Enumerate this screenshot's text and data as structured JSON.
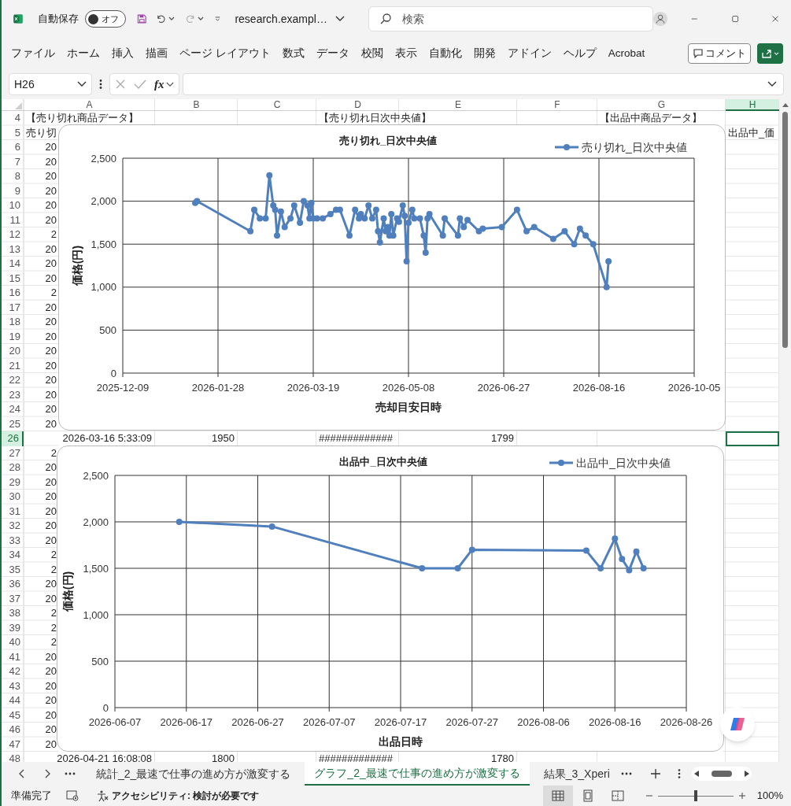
{
  "title_bar": {
    "autosave_label": "自動保存",
    "autosave_on": false,
    "autosave_text": "オフ",
    "filename": "research.exampl…",
    "search": {
      "placeholder": "検索"
    }
  },
  "ribbon_tabs": [
    "ファイル",
    "ホーム",
    "挿入",
    "描画",
    "ページ レイアウト",
    "数式",
    "データ",
    "校閲",
    "表示",
    "自動化",
    "開発",
    "アドイン",
    "ヘルプ",
    "Acrobat"
  ],
  "comment_button": "コメント",
  "formula_bar": {
    "name_box": "H26",
    "fx": "fx"
  },
  "columns": [
    {
      "label": "A",
      "selected": false
    },
    {
      "label": "B",
      "selected": false
    },
    {
      "label": "C",
      "selected": false
    },
    {
      "label": "D",
      "selected": false
    },
    {
      "label": "E",
      "selected": false
    },
    {
      "label": "F",
      "selected": false
    },
    {
      "label": "G",
      "selected": false
    },
    {
      "label": "H",
      "selected": true
    }
  ],
  "rows": [
    {
      "number": "4",
      "selected": false,
      "cells": {
        "a": {
          "text": "【売り切れ商品データ】",
          "kind": "text"
        },
        "d": {
          "text": "【売り切れ日次中央値】",
          "kind": "text"
        },
        "g": {
          "text": "【出品中商品データ】",
          "kind": "text"
        }
      }
    },
    {
      "number": "5",
      "selected": false,
      "cells": {
        "a": {
          "text": "売り切",
          "kind": "text"
        },
        "h": {
          "text": "出品中_価",
          "kind": "text"
        }
      }
    },
    {
      "number": "6",
      "selected": false,
      "cells": {
        "a": {
          "text": "20",
          "kind": "cut"
        }
      }
    },
    {
      "number": "7",
      "selected": false,
      "cells": {
        "a": {
          "text": "20",
          "kind": "cut"
        }
      }
    },
    {
      "number": "8",
      "selected": false,
      "cells": {
        "a": {
          "text": "20",
          "kind": "cut"
        }
      }
    },
    {
      "number": "9",
      "selected": false,
      "cells": {
        "a": {
          "text": "20",
          "kind": "cut"
        }
      }
    },
    {
      "number": "10",
      "selected": false,
      "cells": {
        "a": {
          "text": "20",
          "kind": "cut"
        }
      }
    },
    {
      "number": "11",
      "selected": false,
      "cells": {
        "a": {
          "text": "20",
          "kind": "cut"
        }
      }
    },
    {
      "number": "12",
      "selected": false,
      "cells": {
        "a": {
          "text": "2",
          "kind": "cut"
        }
      }
    },
    {
      "number": "13",
      "selected": false,
      "cells": {
        "a": {
          "text": "20",
          "kind": "cut"
        }
      }
    },
    {
      "number": "14",
      "selected": false,
      "cells": {
        "a": {
          "text": "20",
          "kind": "cut"
        }
      }
    },
    {
      "number": "15",
      "selected": false,
      "cells": {
        "a": {
          "text": "20",
          "kind": "cut"
        }
      }
    },
    {
      "number": "16",
      "selected": false,
      "cells": {
        "a": {
          "text": "2",
          "kind": "cut"
        }
      }
    },
    {
      "number": "17",
      "selected": false,
      "cells": {
        "a": {
          "text": "20",
          "kind": "cut"
        }
      }
    },
    {
      "number": "18",
      "selected": false,
      "cells": {
        "a": {
          "text": "20",
          "kind": "cut"
        }
      }
    },
    {
      "number": "19",
      "selected": false,
      "cells": {
        "a": {
          "text": "20",
          "kind": "cut"
        }
      }
    },
    {
      "number": "20",
      "selected": false,
      "cells": {
        "a": {
          "text": "20",
          "kind": "cut"
        }
      }
    },
    {
      "number": "21",
      "selected": false,
      "cells": {
        "a": {
          "text": "20",
          "kind": "cut"
        }
      }
    },
    {
      "number": "22",
      "selected": false,
      "cells": {
        "a": {
          "text": "20",
          "kind": "cut"
        }
      }
    },
    {
      "number": "23",
      "selected": false,
      "cells": {
        "a": {
          "text": "20",
          "kind": "cut"
        }
      }
    },
    {
      "number": "24",
      "selected": false,
      "cells": {
        "a": {
          "text": "20",
          "kind": "cut"
        }
      }
    },
    {
      "number": "25",
      "selected": false,
      "cells": {
        "a": {
          "text": "20",
          "kind": "cut"
        }
      }
    },
    {
      "number": "26",
      "selected": true,
      "cells": {
        "a": {
          "text": "2026-03-16 5:33:09",
          "kind": "number"
        },
        "b": {
          "text": "1950",
          "kind": "number"
        },
        "d": {
          "text": "#############",
          "kind": "text"
        },
        "e": {
          "text": "1799",
          "kind": "number"
        }
      }
    },
    {
      "number": "27",
      "selected": false,
      "cells": {
        "a": {
          "text": "2",
          "kind": "cut"
        }
      }
    },
    {
      "number": "28",
      "selected": false,
      "cells": {
        "a": {
          "text": "20",
          "kind": "cut"
        }
      }
    },
    {
      "number": "29",
      "selected": false,
      "cells": {
        "a": {
          "text": "20",
          "kind": "cut"
        }
      }
    },
    {
      "number": "30",
      "selected": false,
      "cells": {
        "a": {
          "text": "20",
          "kind": "cut"
        }
      }
    },
    {
      "number": "31",
      "selected": false,
      "cells": {
        "a": {
          "text": "20",
          "kind": "cut"
        }
      }
    },
    {
      "number": "32",
      "selected": false,
      "cells": {
        "a": {
          "text": "20",
          "kind": "cut"
        }
      }
    },
    {
      "number": "33",
      "selected": false,
      "cells": {
        "a": {
          "text": "20",
          "kind": "cut"
        }
      }
    },
    {
      "number": "34",
      "selected": false,
      "cells": {
        "a": {
          "text": "2",
          "kind": "cut"
        }
      }
    },
    {
      "number": "35",
      "selected": false,
      "cells": {
        "a": {
          "text": "2",
          "kind": "cut"
        }
      }
    },
    {
      "number": "36",
      "selected": false,
      "cells": {
        "a": {
          "text": "20",
          "kind": "cut"
        }
      }
    },
    {
      "number": "37",
      "selected": false,
      "cells": {
        "a": {
          "text": "20",
          "kind": "cut"
        }
      }
    },
    {
      "number": "38",
      "selected": false,
      "cells": {
        "a": {
          "text": "2",
          "kind": "cut"
        }
      }
    },
    {
      "number": "39",
      "selected": false,
      "cells": {
        "a": {
          "text": "2",
          "kind": "cut"
        }
      }
    },
    {
      "number": "40",
      "selected": false,
      "cells": {
        "a": {
          "text": "2",
          "kind": "cut"
        }
      }
    },
    {
      "number": "41",
      "selected": false,
      "cells": {
        "a": {
          "text": "20",
          "kind": "cut"
        }
      }
    },
    {
      "number": "42",
      "selected": false,
      "cells": {
        "a": {
          "text": "20",
          "kind": "cut"
        }
      }
    },
    {
      "number": "43",
      "selected": false,
      "cells": {
        "a": {
          "text": "20",
          "kind": "cut"
        }
      }
    },
    {
      "number": "44",
      "selected": false,
      "cells": {
        "a": {
          "text": "20",
          "kind": "cut"
        }
      }
    },
    {
      "number": "45",
      "selected": false,
      "cells": {
        "a": {
          "text": "20",
          "kind": "cut"
        }
      }
    },
    {
      "number": "46",
      "selected": false,
      "cells": {
        "a": {
          "text": "20",
          "kind": "cut"
        }
      }
    },
    {
      "number": "47",
      "selected": false,
      "cells": {
        "a": {
          "text": "20",
          "kind": "cut"
        }
      }
    },
    {
      "number": "48",
      "selected": false,
      "cells": {
        "a": {
          "text": "2026-04-21 16:08:08",
          "kind": "number"
        },
        "b": {
          "text": "1800",
          "kind": "number"
        },
        "d": {
          "text": "#############",
          "kind": "text"
        },
        "e": {
          "text": "1780",
          "kind": "number"
        }
      }
    }
  ],
  "charts": [
    {
      "chart_data": {
        "type": "line",
        "title": "売り切れ_日次中央値",
        "xlabel": "売却目安日時",
        "ylabel": "価格(円)",
        "grid": true,
        "x": [
          "2026-01-16",
          "2026-01-17",
          "2026-02-14",
          "2026-02-16",
          "2026-02-19",
          "2026-02-22",
          "2026-02-24",
          "2026-02-26",
          "2026-02-27",
          "2026-02-28",
          "2026-03-02",
          "2026-03-04",
          "2026-03-07",
          "2026-03-09",
          "2026-03-12",
          "2026-03-14",
          "2026-03-16",
          "2026-03-17",
          "2026-03-18",
          "2026-03-19",
          "2026-03-21",
          "2026-03-24",
          "2026-03-28",
          "2026-03-31",
          "2026-04-02",
          "2026-04-07",
          "2026-04-10",
          "2026-04-12",
          "2026-04-13",
          "2026-04-15",
          "2026-04-17",
          "2026-04-19",
          "2026-04-21",
          "2026-04-22",
          "2026-04-23",
          "2026-04-25",
          "2026-04-26",
          "2026-04-27",
          "2026-04-28",
          "2026-04-29",
          "2026-04-30",
          "2026-05-02",
          "2026-05-03",
          "2026-05-05",
          "2026-05-06",
          "2026-05-07",
          "2026-05-08",
          "2026-05-10",
          "2026-05-11",
          "2026-05-14",
          "2026-05-16",
          "2026-05-17",
          "2026-05-18",
          "2026-05-19",
          "2026-05-26",
          "2026-05-27",
          "2026-06-03",
          "2026-06-04",
          "2026-06-06",
          "2026-06-08",
          "2026-06-14",
          "2026-06-16",
          "2026-06-26",
          "2026-07-04",
          "2026-07-09",
          "2026-07-13",
          "2026-07-23",
          "2026-07-29",
          "2026-08-03",
          "2026-08-06",
          "2026-08-09",
          "2026-08-13",
          "2026-08-20",
          "2026-08-21"
        ],
        "series": [
          {
            "name": "売り切れ_日次中央値",
            "color": "#4f7fbd",
            "marker": true,
            "values": [
              1980,
              2000,
              1650,
              1900,
              1800,
              1800,
              2300,
              1950,
              1900,
              1600,
              1880,
              1700,
              1800,
              1950,
              1750,
              2000,
              1950,
              1800,
              1980,
              1800,
              1800,
              1800,
              1850,
              1900,
              1900,
              1600,
              1900,
              1800,
              1850,
              1800,
              1950,
              1800,
              1900,
              1650,
              1520,
              1800,
              1650,
              1700,
              1600,
              1850,
              1600,
              1800,
              1760,
              1950,
              1830,
              1300,
              1750,
              1900,
              1800,
              1800,
              1600,
              1400,
              1800,
              1850,
              1600,
              1800,
              1600,
              1800,
              1700,
              1780,
              1650,
              1680,
              1700,
              1900,
              1650,
              1700,
              1560,
              1650,
              1500,
              1680,
              1600,
              1500,
              1000,
              1300
            ]
          }
        ],
        "xlim": [
          "2025-12-09",
          "2026-10-05"
        ],
        "ylim": [
          0,
          2500
        ],
        "xticks": [
          "2025-12-09",
          "2026-01-28",
          "2026-03-19",
          "2026-05-08",
          "2026-06-27",
          "2026-08-16",
          "2026-10-05"
        ],
        "yticks": [
          {
            "value": 0,
            "label": "0"
          },
          {
            "value": 500,
            "label": "500"
          },
          {
            "value": 1000,
            "label": "1,000"
          },
          {
            "value": 1500,
            "label": "1,500"
          },
          {
            "value": 2000,
            "label": "2,000"
          },
          {
            "value": 2500,
            "label": "2,500"
          }
        ]
      }
    },
    {
      "chart_data": {
        "type": "line",
        "title": "出品中_日次中央値",
        "xlabel": "出品日時",
        "ylabel": "価格(円)",
        "grid": true,
        "x": [
          "2026-06-16",
          "2026-06-29",
          "2026-07-20",
          "2026-07-25",
          "2026-07-27",
          "2026-08-12",
          "2026-08-14",
          "2026-08-16",
          "2026-08-17",
          "2026-08-18",
          "2026-08-19",
          "2026-08-20"
        ],
        "series": [
          {
            "name": "出品中_日次中央値",
            "color": "#4f7fbd",
            "marker": true,
            "values": [
              2000,
              1950,
              1500,
              1500,
              1700,
              1690,
              1500,
              1820,
              1600,
              1480,
              1680,
              1500
            ]
          }
        ],
        "xlim": [
          "2026-06-07",
          "2026-08-26"
        ],
        "ylim": [
          0,
          2500
        ],
        "xticks": [
          "2026-06-07",
          "2026-06-17",
          "2026-06-27",
          "2026-07-07",
          "2026-07-17",
          "2026-07-27",
          "2026-08-06",
          "2026-08-16",
          "2026-08-26"
        ],
        "yticks": [
          {
            "value": 0,
            "label": "0"
          },
          {
            "value": 500,
            "label": "500"
          },
          {
            "value": 1000,
            "label": "1,000"
          },
          {
            "value": 1500,
            "label": "1,500"
          },
          {
            "value": 2000,
            "label": "2,000"
          },
          {
            "value": 2500,
            "label": "2,500"
          }
        ]
      }
    }
  ],
  "sheet_tabs": [
    {
      "label": "統計_2_最速で仕事の進め方が激変する",
      "selected": false
    },
    {
      "label": "グラフ_2_最速で仕事の進め方が激変する",
      "selected": true
    },
    {
      "label": "結果_3_Xperi",
      "selected": false
    }
  ],
  "status_bar": {
    "status": "準備完了",
    "accessibility": "アクセシビリティ: 検討が必要です",
    "views": [
      {
        "kind": "normal",
        "selected": true
      },
      {
        "kind": "page_layout",
        "selected": false
      },
      {
        "kind": "page_break",
        "selected": false
      }
    ],
    "zoom": {
      "level": 0.5,
      "reading": "100%"
    }
  }
}
